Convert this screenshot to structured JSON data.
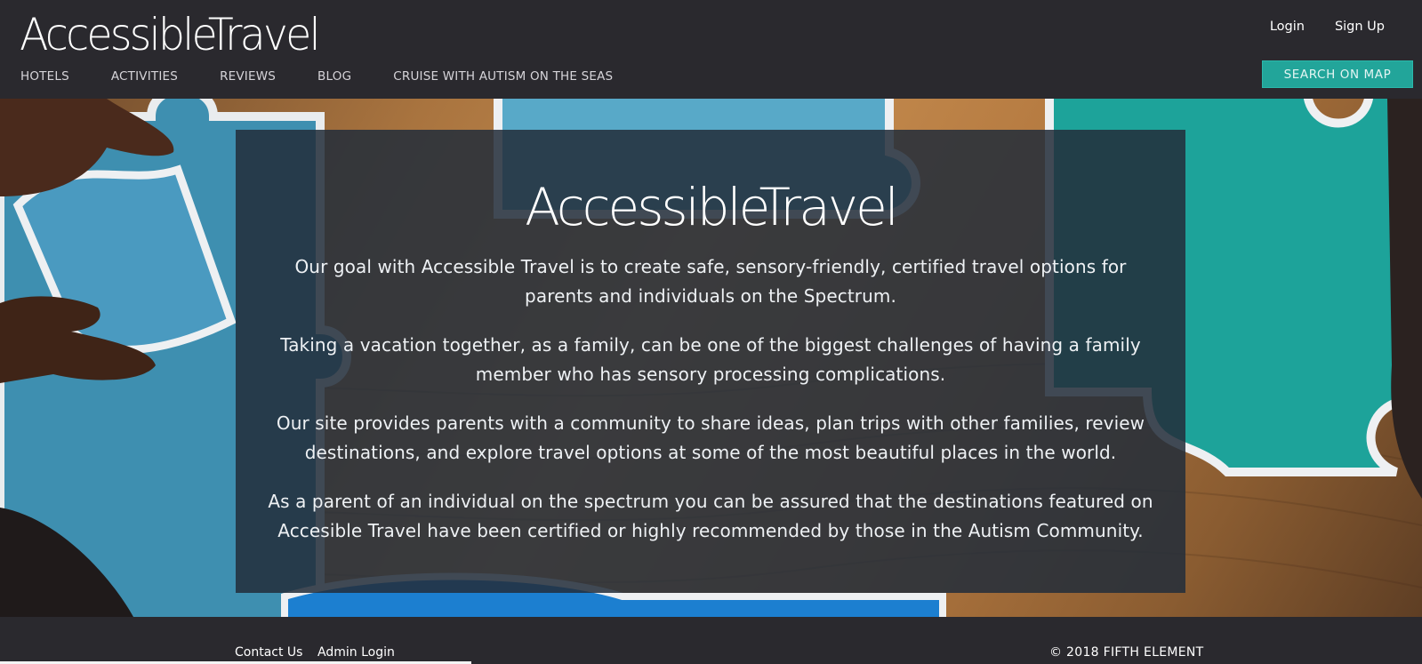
{
  "header": {
    "logo": "AccessibleTravel",
    "nav": [
      "HOTELS",
      "ACTIVITIES",
      "REVIEWS",
      "BLOG",
      "CRUISE WITH AUTISM ON THE SEAS"
    ],
    "login": "Login",
    "signup": "Sign Up",
    "search_map": "SEARCH ON MAP"
  },
  "hero": {
    "title": "AccessibleTravel",
    "paragraphs": [
      "Our goal with Accessible Travel is to create safe, sensory-friendly, certified travel options for parents and individuals on the Spectrum.",
      "Taking a vacation together, as a family, can be one of the biggest challenges of having a family member who has sensory processing complications.",
      "Our site provides parents with a community to share ideas, plan trips with other families, review destinations, and explore travel options at some of the most beautiful places in the world.",
      "As a parent of an individual on the spectrum you can be assured that the destinations featured on Accesible Travel have been certified or highly recommended by those in the Autism Community."
    ]
  },
  "footer": {
    "contact": "Contact Us",
    "admin": "Admin Login",
    "copyright": "© 2018 FIFTH ELEMENT"
  },
  "colors": {
    "header_bg": "#2a292e",
    "accent": "#22a59a",
    "panel_bg": "#232d3a"
  }
}
